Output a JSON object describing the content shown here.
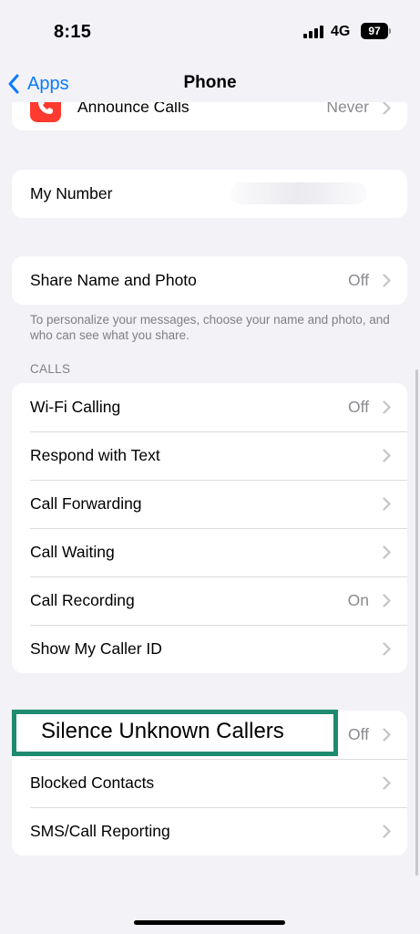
{
  "status_bar": {
    "time": "8:15",
    "network": "4G",
    "battery": "97"
  },
  "nav": {
    "back_label": "Apps",
    "title": "Phone"
  },
  "group_top": {
    "label": "Announce Calls",
    "value": "Never"
  },
  "group_my_number": {
    "label": "My Number"
  },
  "group_share": {
    "label": "Share Name and Photo",
    "value": "Off",
    "footer": "To personalize your messages, choose your name and photo, and who can see what you share."
  },
  "calls_section": {
    "header": "CALLS",
    "rows": [
      {
        "label": "Wi-Fi Calling",
        "value": "Off"
      },
      {
        "label": "Respond with Text",
        "value": ""
      },
      {
        "label": "Call Forwarding",
        "value": ""
      },
      {
        "label": "Call Waiting",
        "value": ""
      },
      {
        "label": "Call Recording",
        "value": "On"
      },
      {
        "label": "Show My Caller ID",
        "value": ""
      }
    ]
  },
  "blocking_section": {
    "rows": [
      {
        "label": "Silence Unknown Callers",
        "value": "Off"
      },
      {
        "label": "Blocked Contacts",
        "value": ""
      },
      {
        "label": "SMS/Call Reporting",
        "value": ""
      }
    ]
  },
  "colors": {
    "accent": "#0a7aff",
    "highlight": "#1f8a70",
    "phone_icon": "#ff3b30",
    "background": "#f2f2f7"
  }
}
